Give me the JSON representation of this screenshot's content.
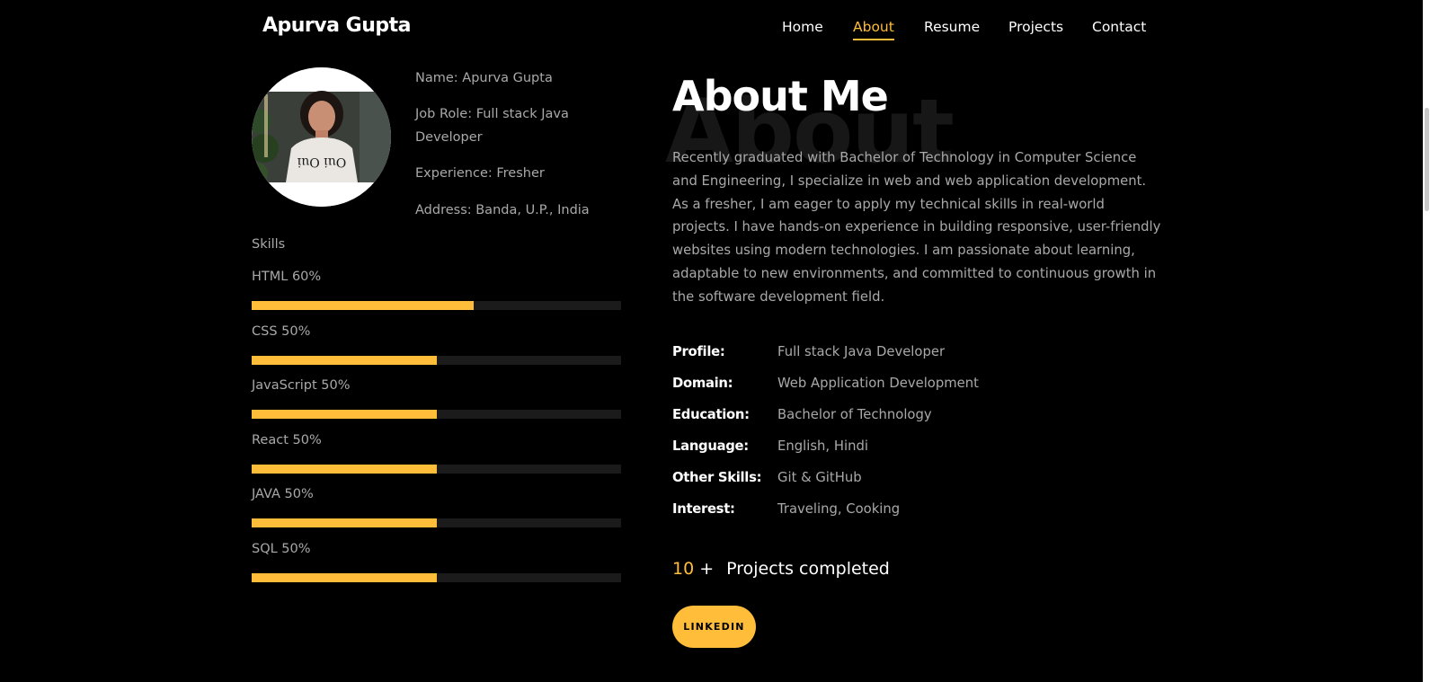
{
  "nav": {
    "brand": "Apurva Gupta",
    "links": [
      "Home",
      "About",
      "Resume",
      "Projects",
      "Contact"
    ],
    "active": "About"
  },
  "profile": {
    "photo_icon": "profile-photo",
    "name": "Name: Apurva Gupta",
    "job_role": "Job Role: Full stack Java Developer",
    "experience": "Experience: Fresher",
    "address": "Address: Banda, U.P., India"
  },
  "skills": {
    "title": "Skills",
    "items": [
      {
        "label": "HTML 60%",
        "percent": 60
      },
      {
        "label": "CSS 50%",
        "percent": 50
      },
      {
        "label": "JavaScript 50%",
        "percent": 50
      },
      {
        "label": "React 50%",
        "percent": 50
      },
      {
        "label": "JAVA 50%",
        "percent": 50
      },
      {
        "label": "SQL 50%",
        "percent": 50
      }
    ]
  },
  "about": {
    "bg_word": "About",
    "heading": "About Me",
    "text": "Recently graduated with Bachelor of Technology in Computer Science and Engineering, I specialize in web and web application development. As a fresher, I am eager to apply my technical skills in real-world projects. I have hands-on experience in building responsive, user-friendly websites using modern technologies. I am passionate about learning, adaptable to new environments, and committed to continuous growth in the software development field.",
    "details": [
      {
        "key": "Profile:",
        "value": "Full stack Java Developer"
      },
      {
        "key": "Domain:",
        "value": "Web Application Development"
      },
      {
        "key": "Education:",
        "value": "Bachelor of Technology"
      },
      {
        "key": "Language:",
        "value": "English, Hindi"
      },
      {
        "key": "Other Skills:",
        "value": "Git & GitHub"
      },
      {
        "key": "Interest:",
        "value": "Traveling, Cooking"
      }
    ],
    "counter": {
      "number": "10",
      "plus": "+",
      "label": "Projects completed"
    },
    "linkedin_label": "LINKEDIN"
  },
  "colors": {
    "accent": "#ffbd39",
    "background": "#000000",
    "muted_text": "#a9a9a9",
    "track": "#1b1b1b"
  }
}
